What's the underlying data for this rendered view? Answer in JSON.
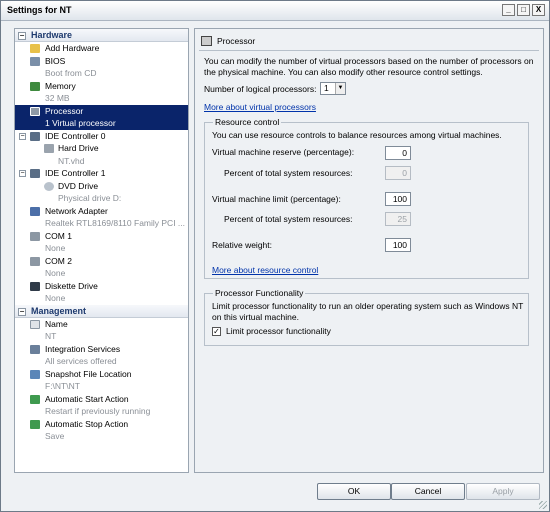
{
  "window": {
    "title": "Settings for NT",
    "minimize_glyph": "_",
    "maximize_glyph": "□",
    "close_glyph": "X"
  },
  "hardware": {
    "section_label": "Hardware",
    "toggle_glyph": "−",
    "items": {
      "add_hardware": "Add Hardware",
      "bios": "BIOS",
      "bios_sub": "Boot from CD",
      "memory": "Memory",
      "memory_sub": "32 MB",
      "processor": "Processor",
      "processor_sub": "1 Virtual processor",
      "ide0": "IDE Controller 0",
      "hard_drive": "Hard Drive",
      "hard_drive_sub": "NT.vhd",
      "ide1": "IDE Controller 1",
      "dvd_drive": "DVD Drive",
      "dvd_drive_sub": "Physical drive D:",
      "network_adapter": "Network Adapter",
      "network_adapter_sub": "Realtek RTL8169/8110 Family PCI ...",
      "com1": "COM 1",
      "com1_sub": "None",
      "com2": "COM 2",
      "com2_sub": "None",
      "diskette": "Diskette Drive",
      "diskette_sub": "None"
    }
  },
  "management": {
    "section_label": "Management",
    "toggle_glyph": "−",
    "items": {
      "name": "Name",
      "name_sub": "NT",
      "integration": "Integration Services",
      "integration_sub": "All services offered",
      "snapshot": "Snapshot File Location",
      "snapshot_sub": "F:\\NT\\NT",
      "auto_start": "Automatic Start Action",
      "auto_start_sub": "Restart if previously running",
      "auto_stop": "Automatic Stop Action",
      "auto_stop_sub": "Save"
    }
  },
  "processor_panel": {
    "header": "Processor",
    "description": "You can modify the number of virtual processors based on the number of processors on the physical machine. You can also modify other resource control settings.",
    "logical_processors_label": "Number of logical processors:",
    "logical_processors_value": "1",
    "dropdown_glyph": "▼",
    "more_processors_link": "More about virtual processors"
  },
  "resource_control": {
    "title": "Resource control",
    "description": "You can use resource controls to balance resources among virtual machines.",
    "reserve_label": "Virtual machine reserve (percentage):",
    "reserve_value": "0",
    "reserve_pct_label": "Percent of total system resources:",
    "reserve_pct_value": "0",
    "limit_label": "Virtual machine limit (percentage):",
    "limit_value": "100",
    "limit_pct_label": "Percent of total system resources:",
    "limit_pct_value": "25",
    "weight_label": "Relative weight:",
    "weight_value": "100",
    "more_link": "More about resource control"
  },
  "processor_functionality": {
    "title": "Processor Functionality",
    "description": "Limit processor functionality to run an older operating system such as Windows NT on this virtual machine.",
    "checkbox_label": "Limit processor functionality",
    "check_glyph": "✓"
  },
  "buttons": {
    "ok": "OK",
    "cancel": "Cancel",
    "apply": "Apply"
  }
}
